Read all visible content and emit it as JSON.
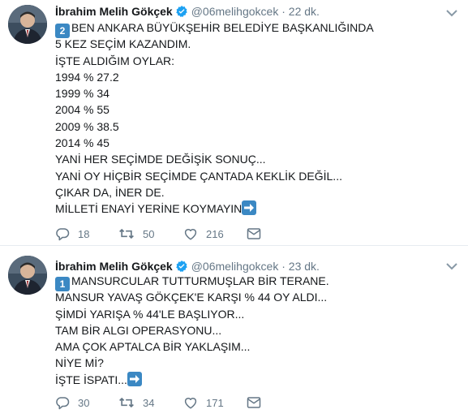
{
  "tweets": [
    {
      "name": "İbrahim Melih Gökçek",
      "handle": "@06melihgokcek",
      "dot": "·",
      "time": "22 dk.",
      "keycap": "2",
      "lines": [
        "BEN ANKARA BÜYÜKŞEHİR BELEDİYE BAŞKANLIĞINDA",
        "5 KEZ SEÇİM KAZANDIM.",
        "İŞTE ALDIĞIM OYLAR:",
        "1994 % 27.2",
        "1999 % 34",
        "2004 % 55",
        "2009 % 38.5",
        "2014 % 45",
        "YANİ HER SEÇİMDE DEĞİŞİK SONUÇ...",
        "YANİ OY HİÇBİR SEÇİMDE ÇANTADA KEKLİK DEĞİL...",
        "ÇIKAR DA, İNER DE.",
        "MİLLETİ ENAYİ YERİNE KOYMAYIN"
      ],
      "replies": "18",
      "retweets": "50",
      "likes": "216"
    },
    {
      "name": "İbrahim Melih Gökçek",
      "handle": "@06melihgokcek",
      "dot": "·",
      "time": "23 dk.",
      "keycap": "1",
      "lines": [
        "MANSURCULAR TUTTURMUŞLAR BİR TERANE.",
        "MANSUR YAVAŞ GÖKÇEK'E KARŞI % 44 OY ALDI...",
        "ŞİMDİ YARIŞA % 44'LE BAŞLIYOR...",
        "TAM BİR ALGI OPERASYONU...",
        "AMA ÇOK APTALCA BİR YAKLAŞIM...",
        "NİYE Mİ?",
        "İŞTE İSPATI..."
      ],
      "replies": "30",
      "retweets": "34",
      "likes": "171"
    }
  ],
  "colors": {
    "text": "#14171a",
    "secondary": "#657786",
    "verified": "#1da1f2",
    "keycap": "#3b88c3",
    "divider": "#e6ecf0"
  },
  "icons": [
    "avatar",
    "verified-badge-icon",
    "caret-down-icon",
    "keycap-digit-icon",
    "right-arrow-emoji-icon",
    "reply-icon",
    "retweet-icon",
    "like-icon",
    "direct-message-icon"
  ]
}
